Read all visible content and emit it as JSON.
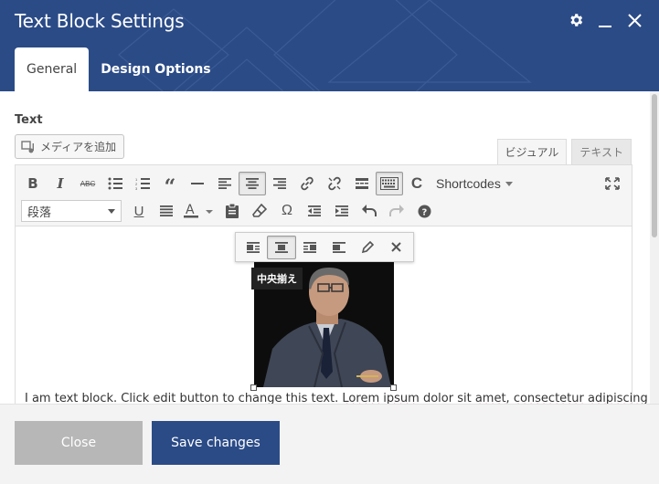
{
  "header": {
    "title": "Text Block Settings",
    "bg_color": "#2b4b87",
    "icons": [
      "gear-icon",
      "minimize-icon",
      "close-icon"
    ]
  },
  "tabs": [
    {
      "label": "General",
      "active": true
    },
    {
      "label": "Design Options",
      "active": false
    }
  ],
  "field": {
    "label": "Text",
    "media_button": "メディアを追加"
  },
  "editor_modes": {
    "visual": "ビジュアル",
    "text": "テキスト",
    "active": "visual"
  },
  "toolbar": {
    "row1": [
      "bold",
      "italic",
      "strikethrough",
      "bullet-list",
      "numbered-list",
      "blockquote",
      "horizontal-rule",
      "align-left",
      "align-center",
      "align-right",
      "link",
      "unlink",
      "read-more",
      "toolbar-toggle",
      "shortcodes-logo"
    ],
    "shortcodes_label": "Shortcodes",
    "row2_format_value": "段落",
    "row2": [
      "underline",
      "justify",
      "text-color",
      "paste-text",
      "clear-formatting",
      "special-character",
      "outdent",
      "indent",
      "undo",
      "redo",
      "help"
    ],
    "pressed": [
      "align-center",
      "toolbar-toggle"
    ]
  },
  "image_toolbar": {
    "buttons": [
      "image-align-left",
      "image-align-center",
      "image-align-right",
      "image-align-none",
      "edit-image",
      "remove-image"
    ],
    "active": "image-align-center",
    "tooltip": "中央揃え"
  },
  "content": {
    "text_parts": [
      {
        "t": "I am text block. Click edit button to change this text. ",
        "spell": false
      },
      {
        "t": "Lorem",
        "spell": true
      },
      {
        "t": " ",
        "spell": false
      },
      {
        "t": "ipsum",
        "spell": true
      },
      {
        "t": " dolor sit ",
        "spell": false
      },
      {
        "t": "amet",
        "spell": true
      },
      {
        "t": ", ",
        "spell": false
      },
      {
        "t": "consectetur",
        "spell": true
      },
      {
        "t": " ",
        "spell": false
      },
      {
        "t": "adipiscing",
        "spell": true
      }
    ]
  },
  "footer": {
    "close_label": "Close",
    "save_label": "Save changes",
    "close_color": "#b7b7b7",
    "save_color": "#2b4b87"
  }
}
